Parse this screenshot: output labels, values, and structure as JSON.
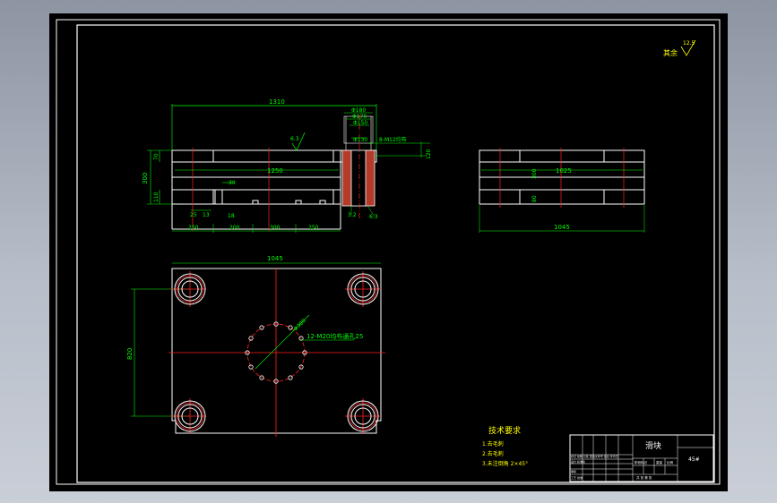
{
  "drawing": {
    "title_block_name": "滑块",
    "title_block_code": "45#",
    "roughness_label": "其余",
    "roughness_value": "12.5"
  },
  "tech_requirements": {
    "heading": "技术要求",
    "items": [
      "1.去毛刺",
      "2.去毛刺",
      "3.未注倒角 2×45°"
    ]
  },
  "front_view": {
    "overall_width": "1310",
    "inner_width": "1250",
    "height": "300",
    "lower_height": "110",
    "top_thk": "70",
    "notch": "30",
    "step1": "25",
    "step2": "13",
    "step3": "18",
    "bottom_dims": [
      "250",
      "200",
      "300",
      "250"
    ],
    "roughness_mark": "6.3",
    "bore_dims": [
      "Φ180",
      "Φ170",
      "Φ150",
      "Φ130"
    ],
    "thread_note": "8-M12均布",
    "right_height": "120",
    "bore_roughness_1": "3.2",
    "bore_roughness_2": "6.3"
  },
  "side_view": {
    "overall_width": "1045",
    "inner_width": "1025",
    "height": "300",
    "lower_height": "80"
  },
  "top_view": {
    "width": "1045",
    "height": "820",
    "bolt_circle": "Φ300",
    "hole_note": "12-M20均布通孔25"
  },
  "title_block": {
    "rows": [
      "标记 处数 分区 更改文件号 签名 年月日",
      "设计 标准化",
      "审核",
      "工艺 批准"
    ],
    "right_labels": [
      "阶段标记",
      "重量",
      "比例"
    ],
    "sheet": "共 张 第 张"
  }
}
